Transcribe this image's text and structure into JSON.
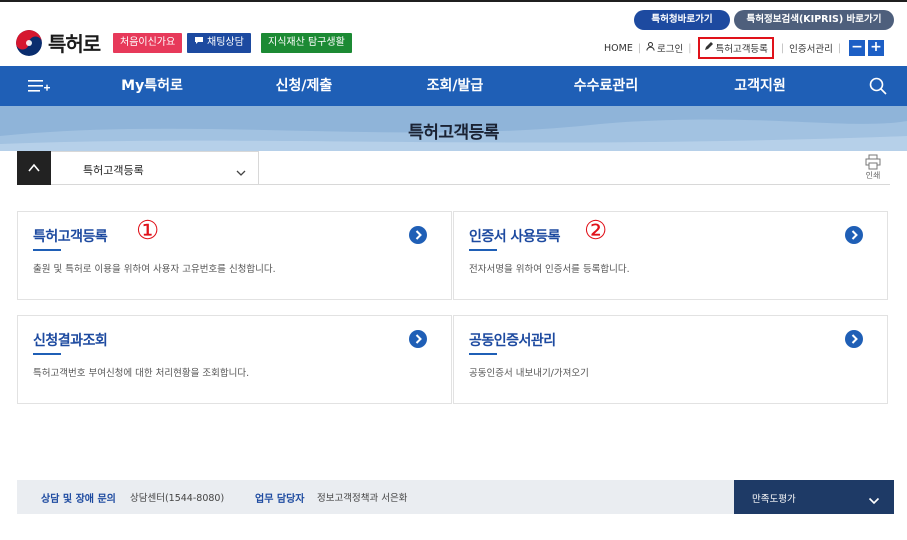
{
  "header": {
    "logo_text": "특허로",
    "chips": [
      "처음이신가요",
      "채팅상담",
      "지식재산 탐구생활"
    ],
    "quick_links": [
      "특허청바로가기",
      "특허정보검색(KIPRIS) 바로가기"
    ],
    "util_links": [
      "HOME",
      "로그인",
      "특허고객등록",
      "인증서관리"
    ],
    "zoom_minus": "−",
    "zoom_plus": "+"
  },
  "nav": {
    "items": [
      "My특허로",
      "신청/제출",
      "조회/발급",
      "수수료관리",
      "고객지원"
    ]
  },
  "page": {
    "title": "특허고객등록",
    "breadcrumb_select": "특허고객등록",
    "print_label": "인쇄"
  },
  "cards": [
    {
      "title": "특허고객등록",
      "desc": "출원 및 특허로 이용을 위하여 사용자 고유번호를 신청합니다.",
      "marker": "①"
    },
    {
      "title": "인증서 사용등록",
      "desc": "전자서명을 위하여 인증서를 등록합니다.",
      "marker": "②"
    },
    {
      "title": "신청결과조회",
      "desc": "특허고객번호 부여신청에 대한 처리현황을 조회합니다."
    },
    {
      "title": "공동인증서관리",
      "desc": "공동인증서 내보내기/가져오기"
    }
  ],
  "footer": {
    "support_label": "상담 및 장애 문의",
    "support_value": "상담센터(1544-8080)",
    "owner_label": "업무 담당자",
    "owner_value": "정보고객정책과 서은화",
    "survey_label": "만족도평가"
  },
  "colors": {
    "nav": "#1f5fb6",
    "accent_red": "#e0121a",
    "title_blue": "#1d4aa0"
  },
  "icons": [
    "korea-emblem-icon",
    "chat-icon",
    "user-icon",
    "pencil-icon",
    "menu-icon",
    "search-icon",
    "home-icon",
    "chevron-down-icon",
    "print-icon",
    "arrow-right-circle-icon"
  ]
}
